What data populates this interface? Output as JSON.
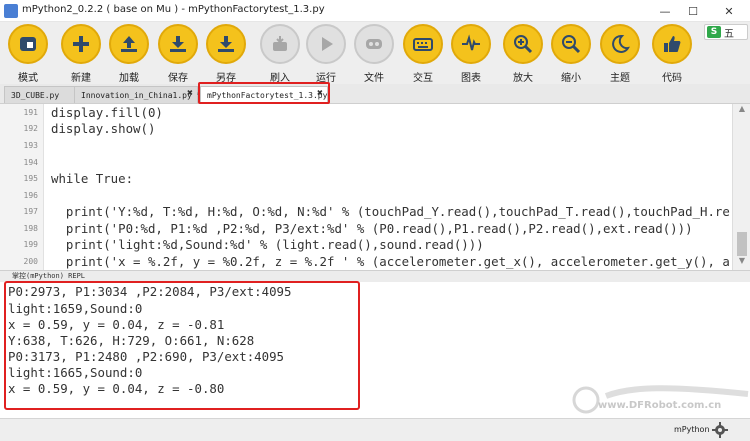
{
  "window": {
    "title": "mPython2_0.2.2 ( base on Mu ) - mPythonFactorytest_1.3.py",
    "min": "—",
    "max": "☐",
    "close": "✕"
  },
  "ime": {
    "label": "五",
    "logo": "S"
  },
  "toolbar": {
    "items": [
      {
        "label": "模式",
        "icon": "mode-icon",
        "enabled": true
      },
      {
        "label": "新建",
        "icon": "plus-icon",
        "enabled": true
      },
      {
        "label": "加载",
        "icon": "upload-icon",
        "enabled": true
      },
      {
        "label": "保存",
        "icon": "download-icon",
        "enabled": true
      },
      {
        "label": "另存",
        "icon": "save-as-icon",
        "enabled": true
      },
      {
        "label": "刷入",
        "icon": "flash-icon",
        "enabled": false
      },
      {
        "label": "运行",
        "icon": "play-icon",
        "enabled": false
      },
      {
        "label": "文件",
        "icon": "files-icon",
        "enabled": false
      },
      {
        "label": "交互",
        "icon": "keyboard-icon",
        "enabled": true
      },
      {
        "label": "图表",
        "icon": "chart-pulse-icon",
        "enabled": true
      },
      {
        "label": "放大",
        "icon": "zoom-in-icon",
        "enabled": true
      },
      {
        "label": "缩小",
        "icon": "zoom-out-icon",
        "enabled": true
      },
      {
        "label": "主题",
        "icon": "moon-icon",
        "enabled": true
      },
      {
        "label": "代码",
        "icon": "thumbs-up-icon",
        "enabled": true
      }
    ]
  },
  "tabs": [
    {
      "label": "3D_CUBE.py",
      "close": "✖"
    },
    {
      "label": "Innovation_in_China1.py *",
      "close": "✖"
    },
    {
      "label": "mPythonFactorytest_1.3.py",
      "close": "✖"
    }
  ],
  "editor": {
    "lines": [
      {
        "num": "191",
        "code": "display.fill(0)"
      },
      {
        "num": "192",
        "code": "display.show()"
      },
      {
        "num": "193",
        "code": ""
      },
      {
        "num": "194",
        "code": ""
      },
      {
        "num": "195",
        "code": "while True:"
      },
      {
        "num": "196",
        "code": ""
      },
      {
        "num": "197",
        "code": "  print('Y:%d, T:%d, H:%d, O:%d, N:%d' % (touchPad_Y.read(),touchPad_T.read(),touchPad_H.re"
      },
      {
        "num": "198",
        "code": "  print('P0:%d, P1:%d ,P2:%d, P3/ext:%d' % (P0.read(),P1.read(),P2.read(),ext.read()))"
      },
      {
        "num": "199",
        "code": "  print('light:%d,Sound:%d' % (light.read(),sound.read()))"
      },
      {
        "num": "200",
        "code": "  print('x = %.2f, y = %0.2f, z = %.2f ' % (accelerometer.get_x(), accelerometer.get_y(), a"
      }
    ]
  },
  "repl": {
    "header": "掌控(mPython) REPL",
    "lines": [
      "P0:2973, P1:3034 ,P2:2084, P3/ext:4095",
      "light:1659,Sound:0",
      "x = 0.59, y = 0.04, z = -0.81",
      "Y:638, T:626, H:729, O:661, N:628",
      "P0:3173, P1:2480 ,P2:690, P3/ext:4095",
      "light:1665,Sound:0",
      "x = 0.59, y = 0.04, z = -0.80"
    ]
  },
  "statusbar": {
    "mode": "mPython"
  },
  "watermark": {
    "text": "www.DFRobot.com.cn"
  },
  "colors": {
    "toolbar_button": "#f4c21c",
    "toolbar_button_disabled": "#e0e0e0",
    "highlight_box": "#e02020"
  }
}
